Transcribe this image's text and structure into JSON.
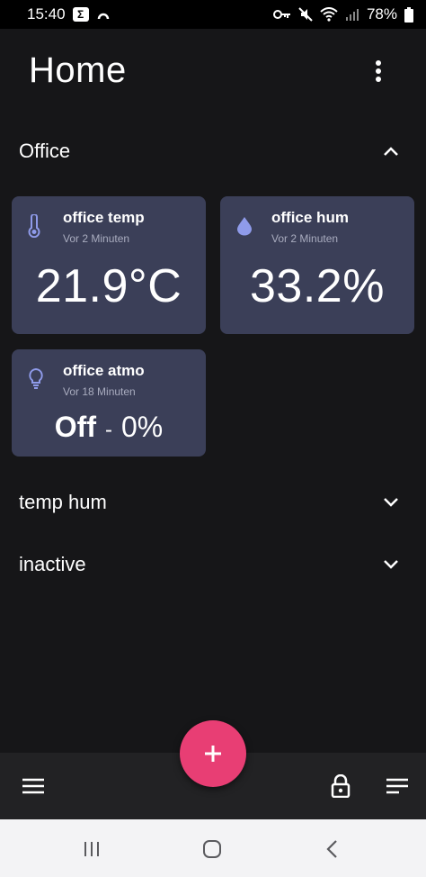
{
  "status_bar": {
    "time": "15:40",
    "badge_letter": "Σ",
    "battery_percent": "78%",
    "icons": [
      "sigma-app-icon",
      "arc-app-icon",
      "key-icon",
      "mute-icon",
      "wifi-icon",
      "signal-icon",
      "battery-icon"
    ]
  },
  "header": {
    "title": "Home",
    "menu_icon": "more-vert-icon"
  },
  "sections": [
    {
      "label": "Office",
      "expanded": true,
      "chevron": "chevron-up-icon"
    },
    {
      "label": "temp hum",
      "expanded": false,
      "chevron": "chevron-down-icon"
    },
    {
      "label": "inactive",
      "expanded": false,
      "chevron": "chevron-down-icon"
    }
  ],
  "cards": [
    {
      "name": "office temp",
      "time": "Vor 2 Minuten",
      "value": "21.9°C",
      "icon": "thermometer-icon"
    },
    {
      "name": "office hum",
      "time": "Vor 2 Minuten",
      "value": "33.2%",
      "icon": "water-drop-icon"
    },
    {
      "name": "office atmo",
      "time": "Vor 18 Minuten",
      "state": "Off",
      "separator": "-",
      "level": "0%",
      "icon": "lightbulb-icon"
    }
  ],
  "bottom_bar": {
    "fab_icon": "plus-icon",
    "left_icon": "hamburger-menu-icon",
    "lock_icon": "lock-icon",
    "sort_icon": "sort-icon"
  },
  "system_nav": [
    "recents-icon",
    "home-icon",
    "back-icon"
  ],
  "colors": {
    "background": "#161618",
    "card": "#3b3f58",
    "accent_fab": "#e83e74",
    "icon_accent": "#8f9bea",
    "secondary_text": "#a9acbf"
  }
}
